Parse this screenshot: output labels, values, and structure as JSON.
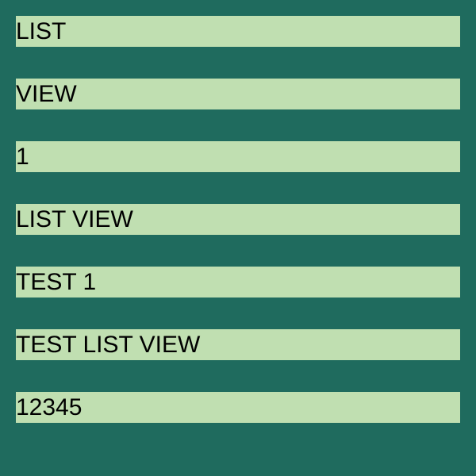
{
  "colors": {
    "background": "#1f6b5e",
    "item_background": "#c0dfb1",
    "text": "#000000"
  },
  "list": {
    "items": [
      {
        "label": "LIST"
      },
      {
        "label": "VIEW"
      },
      {
        "label": "1"
      },
      {
        "label": "LIST VIEW"
      },
      {
        "label": "TEST 1"
      },
      {
        "label": "TEST LIST VIEW"
      },
      {
        "label": "12345"
      }
    ]
  }
}
